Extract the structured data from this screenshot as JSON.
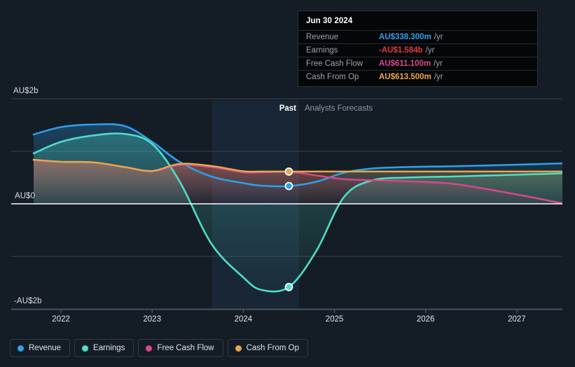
{
  "chart_data": {
    "type": "line",
    "title": "",
    "xlabel": "",
    "ylabel": "",
    "currency": "AU$",
    "x_tick_labels": [
      "2022",
      "2023",
      "2024",
      "2025",
      "2026",
      "2027"
    ],
    "y_tick_labels": [
      "AU$2b",
      "AU$0",
      "-AU$2b"
    ],
    "ylim": [
      -2000,
      2000
    ],
    "y_gridlines": [
      2000,
      1000,
      0,
      -1000,
      -2000
    ],
    "grid": true,
    "legend_position": "bottom-left",
    "divider_label_past": "Past",
    "divider_label_forecast": "Analysts Forecasts",
    "divider_x_value": 2024.5,
    "series": [
      {
        "name": "Revenue",
        "color": "#2e9fe8",
        "x": [
          2021.7,
          2022.0,
          2022.35,
          2022.7,
          2023.0,
          2023.3,
          2023.65,
          2024.0,
          2024.2,
          2024.5,
          2024.8,
          2025.1,
          2025.4,
          2025.8,
          2026.3,
          2026.9,
          2027.5
        ],
        "values": [
          1320,
          1460,
          1510,
          1480,
          1180,
          800,
          520,
          395,
          345,
          338.3,
          420,
          590,
          670,
          700,
          715,
          740,
          770
        ]
      },
      {
        "name": "Earnings",
        "color": "#4fdec7",
        "x": [
          2021.7,
          2022.0,
          2022.35,
          2022.7,
          2023.0,
          2023.3,
          2023.65,
          2024.0,
          2024.2,
          2024.5,
          2024.8,
          2025.1,
          2025.4,
          2025.8,
          2026.3,
          2026.9,
          2027.5
        ],
        "values": [
          960,
          1180,
          1300,
          1330,
          1140,
          430,
          -760,
          -1400,
          -1640,
          -1584,
          -900,
          120,
          440,
          500,
          520,
          550,
          580
        ]
      },
      {
        "name": "Free Cash Flow",
        "color": "#d6478c",
        "x": [
          2021.7,
          2022.0,
          2022.35,
          2022.7,
          2023.0,
          2023.3,
          2023.65,
          2024.0,
          2024.2,
          2024.5,
          2024.8,
          2025.1,
          2025.4,
          2025.8,
          2026.3,
          2026.9,
          2027.5
        ],
        "values": [
          830,
          800,
          790,
          700,
          620,
          740,
          700,
          600,
          600,
          611.1,
          540,
          470,
          450,
          430,
          380,
          210,
          10
        ]
      },
      {
        "name": "Cash From Op",
        "color": "#e8a64a",
        "x": [
          2021.7,
          2022.0,
          2022.35,
          2022.7,
          2023.0,
          2023.3,
          2023.65,
          2024.0,
          2024.2,
          2024.5,
          2024.8,
          2025.1,
          2025.4,
          2025.8,
          2026.3,
          2026.9,
          2027.5
        ],
        "values": [
          840,
          800,
          790,
          700,
          625,
          760,
          720,
          620,
          615,
          613.5,
          615,
          615,
          615,
          615,
          615,
          615,
          615
        ]
      }
    ],
    "markers": [
      {
        "series": "Cash From Op",
        "x": 2024.5,
        "value": 613.5
      },
      {
        "series": "Revenue",
        "x": 2024.5,
        "value": 338.3
      },
      {
        "series": "Earnings",
        "x": 2024.5,
        "value": -1584
      }
    ]
  },
  "tooltip": {
    "date": "Jun 30 2024",
    "rows": [
      {
        "label": "Revenue",
        "value": "AU$338.300m",
        "unit": "/yr",
        "color": "#2e9fe8"
      },
      {
        "label": "Earnings",
        "value": "-AU$1.584b",
        "unit": "/yr",
        "color": "#e23b3b"
      },
      {
        "label": "Free Cash Flow",
        "value": "AU$611.100m",
        "unit": "/yr",
        "color": "#d6478c"
      },
      {
        "label": "Cash From Op",
        "value": "AU$613.500m",
        "unit": "/yr",
        "color": "#e8a64a"
      }
    ]
  },
  "legend": {
    "items": [
      {
        "label": "Revenue",
        "color": "#2e9fe8"
      },
      {
        "label": "Earnings",
        "color": "#4fdec7"
      },
      {
        "label": "Free Cash Flow",
        "color": "#d6478c"
      },
      {
        "label": "Cash From Op",
        "color": "#e8a64a"
      }
    ]
  },
  "axes": {
    "y_labels": [
      "AU$2b",
      "AU$0",
      "-AU$2b"
    ],
    "x_labels": [
      "2022",
      "2023",
      "2024",
      "2025",
      "2026",
      "2027"
    ]
  },
  "bands": {
    "past": "Past",
    "forecast": "Analysts Forecasts"
  }
}
